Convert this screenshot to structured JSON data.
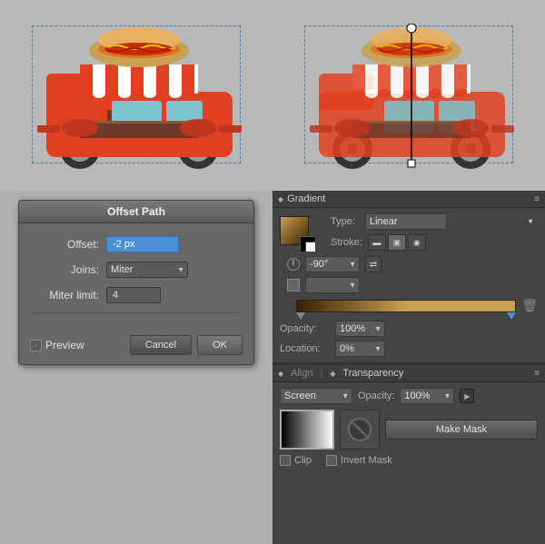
{
  "canvas": {
    "background": "#b8b8b8"
  },
  "offset_path_dialog": {
    "title": "Offset Path",
    "offset_label": "Offset:",
    "offset_value": "-2 px",
    "joins_label": "Joins:",
    "joins_value": "Miter",
    "miter_limit_label": "Miter limit:",
    "miter_limit_value": "4",
    "preview_label": "Preview",
    "cancel_label": "Cancel",
    "ok_label": "OK",
    "preview_checked": true
  },
  "gradient_panel": {
    "title": "Gradient",
    "type_label": "Type:",
    "type_value": "Linear",
    "stroke_label": "Stroke:",
    "angle_value": "-90°",
    "opacity_label": "Opacity:",
    "opacity_value": "100%",
    "location_label": "Location:",
    "location_value": "0%"
  },
  "transparency_panel": {
    "title": "Transparency",
    "align_label": "Align",
    "blend_label": "Screen",
    "opacity_label": "Opacity:",
    "opacity_value": "100%",
    "make_mask_label": "Make Mask",
    "clip_label": "Clip",
    "invert_mask_label": "Invert Mask"
  }
}
